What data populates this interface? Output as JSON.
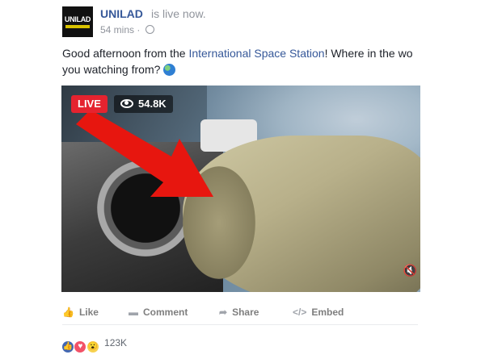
{
  "header": {
    "avatar_text": "UNILAD",
    "page_name": "UNILAD",
    "status": "is live now.",
    "time": "54 mins ·"
  },
  "post": {
    "text_before": "Good afternoon from the ",
    "text_link": "International Space Station",
    "text_after_line1": "! Where in the wo",
    "text_line2": "you watching from?"
  },
  "video": {
    "live_label": "LIVE",
    "viewers": "54.8K",
    "mute": "🔇"
  },
  "actions": {
    "like": "Like",
    "comment": "Comment",
    "share": "Share",
    "embed": "Embed"
  },
  "reactions": {
    "count": "123K"
  }
}
